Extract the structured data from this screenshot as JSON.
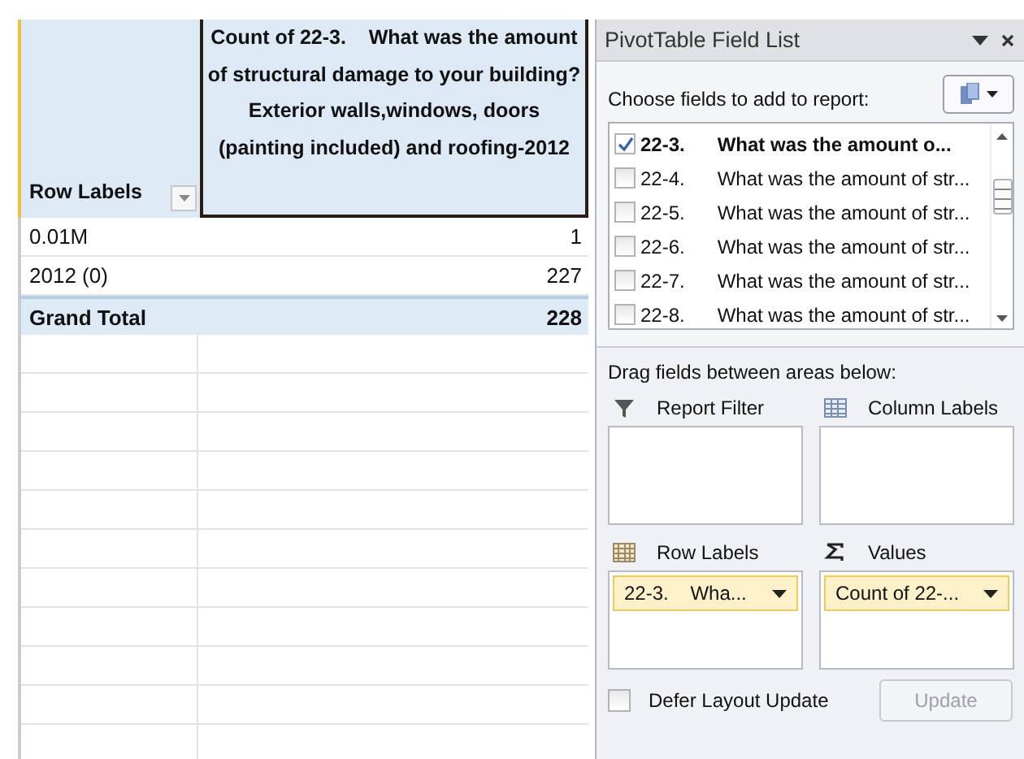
{
  "pivot_table": {
    "row_header": "Row Labels",
    "value_header": "Count of 22-3.    What was the amount of structural damage to your building?Exterior walls,windows, doors (painting included) and roofing-2012",
    "rows": [
      {
        "label": "0.01M",
        "value": "1",
        "kind": "item"
      },
      {
        "label": "2012 (0)",
        "value": "227",
        "kind": "item"
      },
      {
        "label": "Grand Total",
        "value": "228",
        "kind": "total"
      }
    ]
  },
  "field_list": {
    "title": "PivotTable Field List",
    "choose_label": "Choose fields to add to report:",
    "fields": [
      {
        "code": "22-3.",
        "text": "What was the amount o...",
        "checked": true
      },
      {
        "code": "22-4.",
        "text": "What was the amount of str...",
        "checked": false
      },
      {
        "code": "22-5.",
        "text": "What was the amount of str...",
        "checked": false
      },
      {
        "code": "22-6.",
        "text": "What was the amount of str...",
        "checked": false
      },
      {
        "code": "22-7.",
        "text": "What was the amount of str...",
        "checked": false
      },
      {
        "code": "22-8.",
        "text": "What was the amount of str...",
        "checked": false
      }
    ],
    "drag_label": "Drag fields between areas below:",
    "areas": [
      {
        "kind": "filter",
        "label": "Report Filter"
      },
      {
        "kind": "columns",
        "label": "Column Labels"
      },
      {
        "kind": "rows",
        "label": "Row Labels",
        "items": [
          "22-3.    Wha..."
        ]
      },
      {
        "kind": "values",
        "label": "Values",
        "items": [
          "Count of 22-..."
        ]
      }
    ],
    "defer": {
      "label": "Defer Layout Update",
      "checked": false
    },
    "update_button": {
      "label": "Update",
      "disabled": true
    }
  }
}
